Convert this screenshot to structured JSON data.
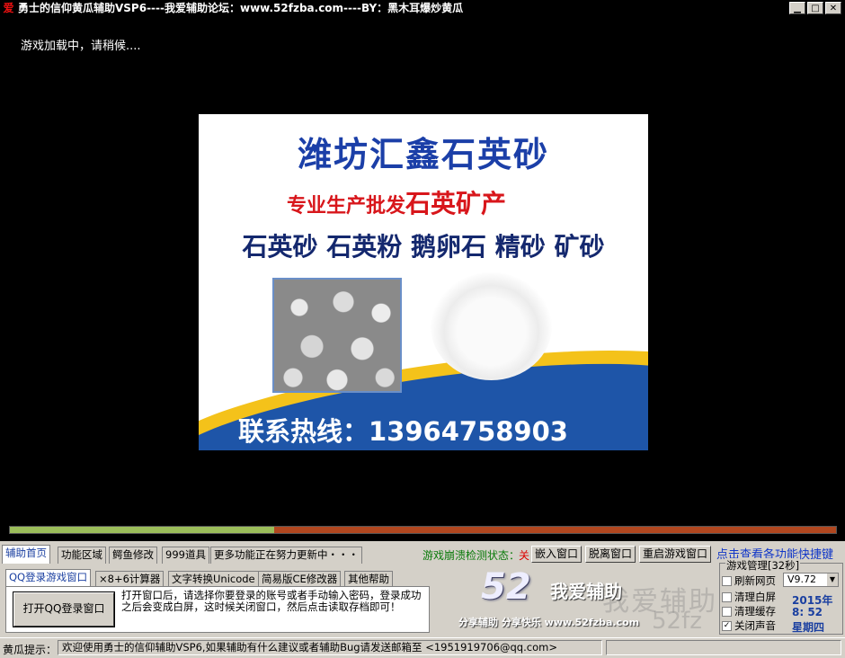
{
  "window": {
    "title": "勇士的信仰黄瓜辅助VSP6----我爱辅助论坛：www.52fzba.com----BY：黑木耳爆炒黄瓜",
    "app_icon_glyph": "爱",
    "controls": {
      "minimize": "▁",
      "maximize": "□",
      "close": "✕"
    }
  },
  "game_area": {
    "loading_text": "游戏加载中，请稍候....",
    "ad": {
      "title": "潍坊汇鑫石英砂",
      "subtitle_prefix": "专业生产批发",
      "subtitle_highlight": "石英矿产",
      "products": "石英砂 石英粉 鹅卵石 精砂 矿砂",
      "phone": "联系热线：13964758903"
    },
    "progress_percent": 32
  },
  "main_tabs": [
    {
      "label": "辅助首页",
      "active": true
    },
    {
      "label": "功能区域",
      "active": false
    },
    {
      "label": "鳄鱼修改",
      "active": false
    },
    {
      "label": "999道具",
      "active": false
    },
    {
      "label": "更多功能正在努力更新中・・・",
      "active": false
    }
  ],
  "crash_check": {
    "label": "游戏崩溃检测状态：",
    "state": "关"
  },
  "window_buttons": {
    "embed": "嵌入窗口",
    "detach": "脱离窗口",
    "restart": "重启游戏窗口"
  },
  "shortcut_link": "点击查看各功能快捷键",
  "sub_tabs": [
    {
      "label": "QQ登录游戏窗口",
      "active": true
    },
    {
      "label": "×8+6计算器",
      "active": false
    },
    {
      "label": "文字转换Unicode",
      "active": false
    },
    {
      "label": "简易版CE修改器",
      "active": false
    },
    {
      "label": "其他帮助",
      "active": false
    }
  ],
  "qq_login": {
    "button": "打开QQ登录窗口",
    "help": "打开窗口后，请选择你要登录的账号或者手动输入密码，登录成功之后会变成白屏，这时候关闭窗口，然后点击读取存档即可！"
  },
  "logo": {
    "number": "52",
    "name": "我爱辅助",
    "slogan": "分享辅助  分享快乐  www.52fzba.com",
    "watermark": "我爱辅助",
    "watermark_url": "52fz"
  },
  "game_mgmt": {
    "title": "游戏管理[32秒]",
    "checkboxes": [
      {
        "label": "刷新网页",
        "checked": false
      },
      {
        "label": "清理白屏",
        "checked": false
      },
      {
        "label": "清理缓存",
        "checked": false
      },
      {
        "label": "关闭声音",
        "checked": true
      }
    ],
    "version": "V9.72",
    "year": "2015年",
    "time": "8: 52",
    "weekday": "星期四"
  },
  "status_bar": {
    "label": "黄瓜提示：",
    "message": "欢迎使用勇士的信仰辅助VSP6,如果辅助有什么建议或者辅助Bug请发送邮箱至 <1951919706@qq.com>"
  },
  "colors": {
    "progress_fill": "#9bbd5a",
    "progress_track": "#b1471f",
    "link": "#1036c8",
    "crash_label": "#0a7a0a",
    "crash_off": "#d00000"
  }
}
